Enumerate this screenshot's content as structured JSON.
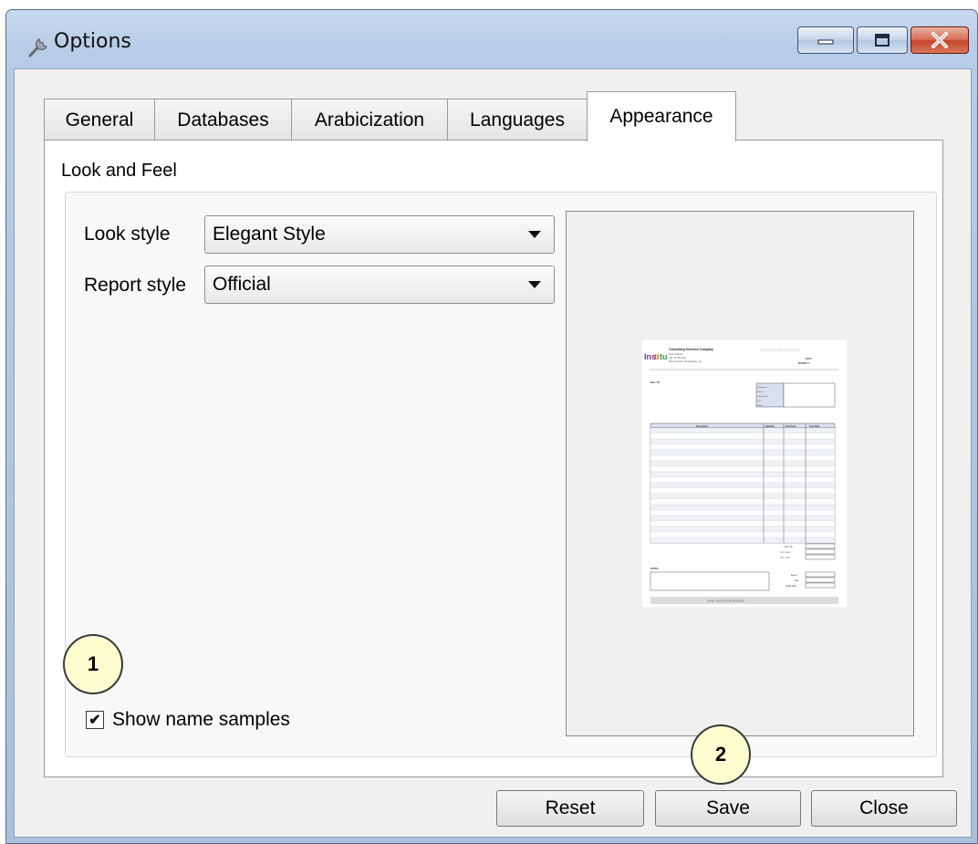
{
  "window": {
    "title": "Options"
  },
  "tabs": [
    {
      "label": "General",
      "active": false
    },
    {
      "label": "Databases",
      "active": false
    },
    {
      "label": "Arabicization",
      "active": false
    },
    {
      "label": "Languages",
      "active": false
    },
    {
      "label": "Appearance",
      "active": true
    }
  ],
  "appearance": {
    "section_title": "Look and Feel",
    "look_style": {
      "label": "Look style",
      "value": "Elegant Style"
    },
    "report_style": {
      "label": "Report style",
      "value": "Official"
    },
    "show_name_samples": {
      "label": "Show name samples",
      "checked": true,
      "check_mark": "✔"
    }
  },
  "preview_invoice": {
    "company": "Consulting Services Company",
    "heading": "CONSULTING INVOICE",
    "address_lines": [
      "Street Address",
      "City, ST  ZIP Code",
      "Phone Number, Web Address, etc."
    ],
    "date_label": "DATE:",
    "invoice_label": "INVOICE #:",
    "bill_to_label": "BILL TO:",
    "meta_labels": [
      "Requisition #",
      "Matter #",
      "Client Code #",
      "P.O. #",
      "Terms"
    ],
    "columns": [
      "Description",
      "Quantity",
      "Unit Price",
      "Line Total"
    ],
    "subtotal_label": "SUBTOTAL",
    "tax_labels": [
      "PST  0.000%",
      "GST  0.000%"
    ],
    "notes_label": "NOTES:",
    "totals_labels": [
      "Ext fee",
      "Paid",
      "TOTAL DUE"
    ],
    "footer": "THANK YOU FOR YOUR BUSINESS!"
  },
  "callouts": [
    "1",
    "2"
  ],
  "buttons": {
    "reset": "Reset",
    "save": "Save",
    "close": "Close"
  }
}
